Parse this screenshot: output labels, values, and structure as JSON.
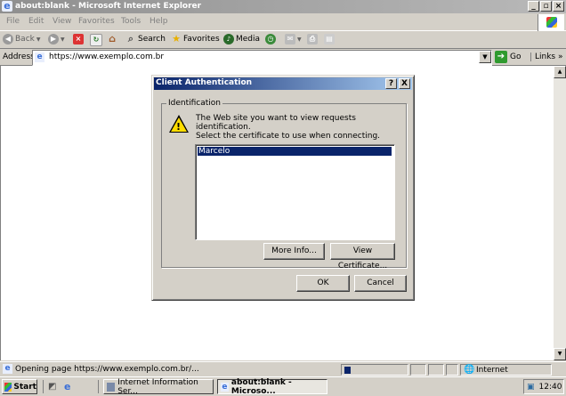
{
  "window": {
    "title": "about:blank - Microsoft Internet Explorer"
  },
  "menu": [
    "File",
    "Edit",
    "View",
    "Favorites",
    "Tools",
    "Help"
  ],
  "toolbar": {
    "back": "Back",
    "search": "Search",
    "favorites": "Favorites",
    "media": "Media"
  },
  "address": {
    "label": "Address",
    "url": "https://www.exemplo.com.br",
    "go": "Go",
    "links": "Links"
  },
  "dialog": {
    "title": "Client Authentication",
    "group_label": "Identification",
    "message_line1": "The Web site you want to view requests identification.",
    "message_line2": "Select the certificate to use when connecting.",
    "certificates": [
      "Marcelo"
    ],
    "more_info": "More Info...",
    "view_certificate": "View Certificate...",
    "ok": "OK",
    "cancel": "Cancel",
    "help_btn": "?",
    "close_btn": "X"
  },
  "status": {
    "text": "Opening page https://www.exemplo.com.br/...",
    "zone": "Internet"
  },
  "taskbar": {
    "start": "Start",
    "tasks": [
      "Internet Information Ser...",
      "about:blank - Microso..."
    ],
    "clock": "12:40"
  }
}
